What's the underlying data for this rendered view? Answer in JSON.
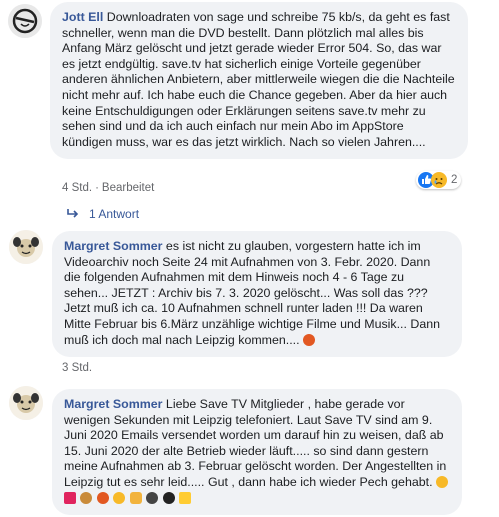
{
  "comments": [
    {
      "author": "Jott Ell",
      "text": "Downloadraten von sage und schreibe 75 kb/s, da geht es fast schneller, wenn man die DVD bestellt. Dann plötzlich mal alles bis Anfang März gelöscht und jetzt gerade wieder Error 504. So, das war es jetzt endgültig. save.tv hat sicherlich einige Vorteile gegenüber anderen ähnlichen Anbietern, aber mittlerweile wiegen die die Nachteile nicht mehr auf. Ich habe euch die Chance gegeben. Aber da hier auch keine Entschuldigungen oder Erklärungen seitens save.tv mehr zu sehen sind und da ich auch einfach nur mein Abo im AppStore kündigen muss, war es das jetzt wirklich. Nach so vielen Jahren....",
      "time": "4 Std.",
      "edited": "Bearbeitet",
      "reaction_count": "2",
      "reactions": [
        "like",
        "sad"
      ],
      "reply_label": "1 Antwort"
    },
    {
      "author": "Margret Sommer",
      "text": "es ist nicht zu glauben, vorgestern hatte ich im Videoarchiv noch Seite 24 mit Aufnahmen von 3. Febr. 2020. Dann die folgenden Aufnahmen mit dem Hinweis noch 4 - 6 Tage zu sehen... JETZT : Archiv bis 7. 3. 2020 gelöscht... Was soll das ??? Jetzt muß ich ca. 10 Aufnahmen schnell runter laden !!! Da waren Mitte Februar bis 6.März unzählige wichtige Filme und Musik... Dann muß ich doch mal nach Leipzig kommen....",
      "trailing_emoji": "angry-face",
      "time": "3 Std."
    },
    {
      "author": "Margret Sommer",
      "text": "Liebe Save TV Mitglieder , habe gerade vor wenigen Sekunden mit Leipzig telefoniert. Laut Save TV sind am 9. Juni 2020 Emails versendet worden um darauf hin zu weisen, daß ab 15. Juni 2020 der alte Betrieb wieder läuft..... so sind dann gestern meine Aufnahmen ab 3. Februar gelöscht worden. Der Angestellten in Leipzig tut es sehr leid..... Gut , dann habe ich wieder Pech gehabt.",
      "trailing_emojis": [
        "crying-face",
        "broken-heart",
        "snail",
        "angry-face",
        "expressionless-face",
        "thumbs-down",
        "gorilla",
        "bomb",
        "lightning"
      ]
    }
  ],
  "colors": {
    "bubble": "#f0f2f5",
    "author": "#385898",
    "meta": "#65676b",
    "like": "#1877f2",
    "sad": "#f7b928",
    "angry": "#e9710f"
  }
}
